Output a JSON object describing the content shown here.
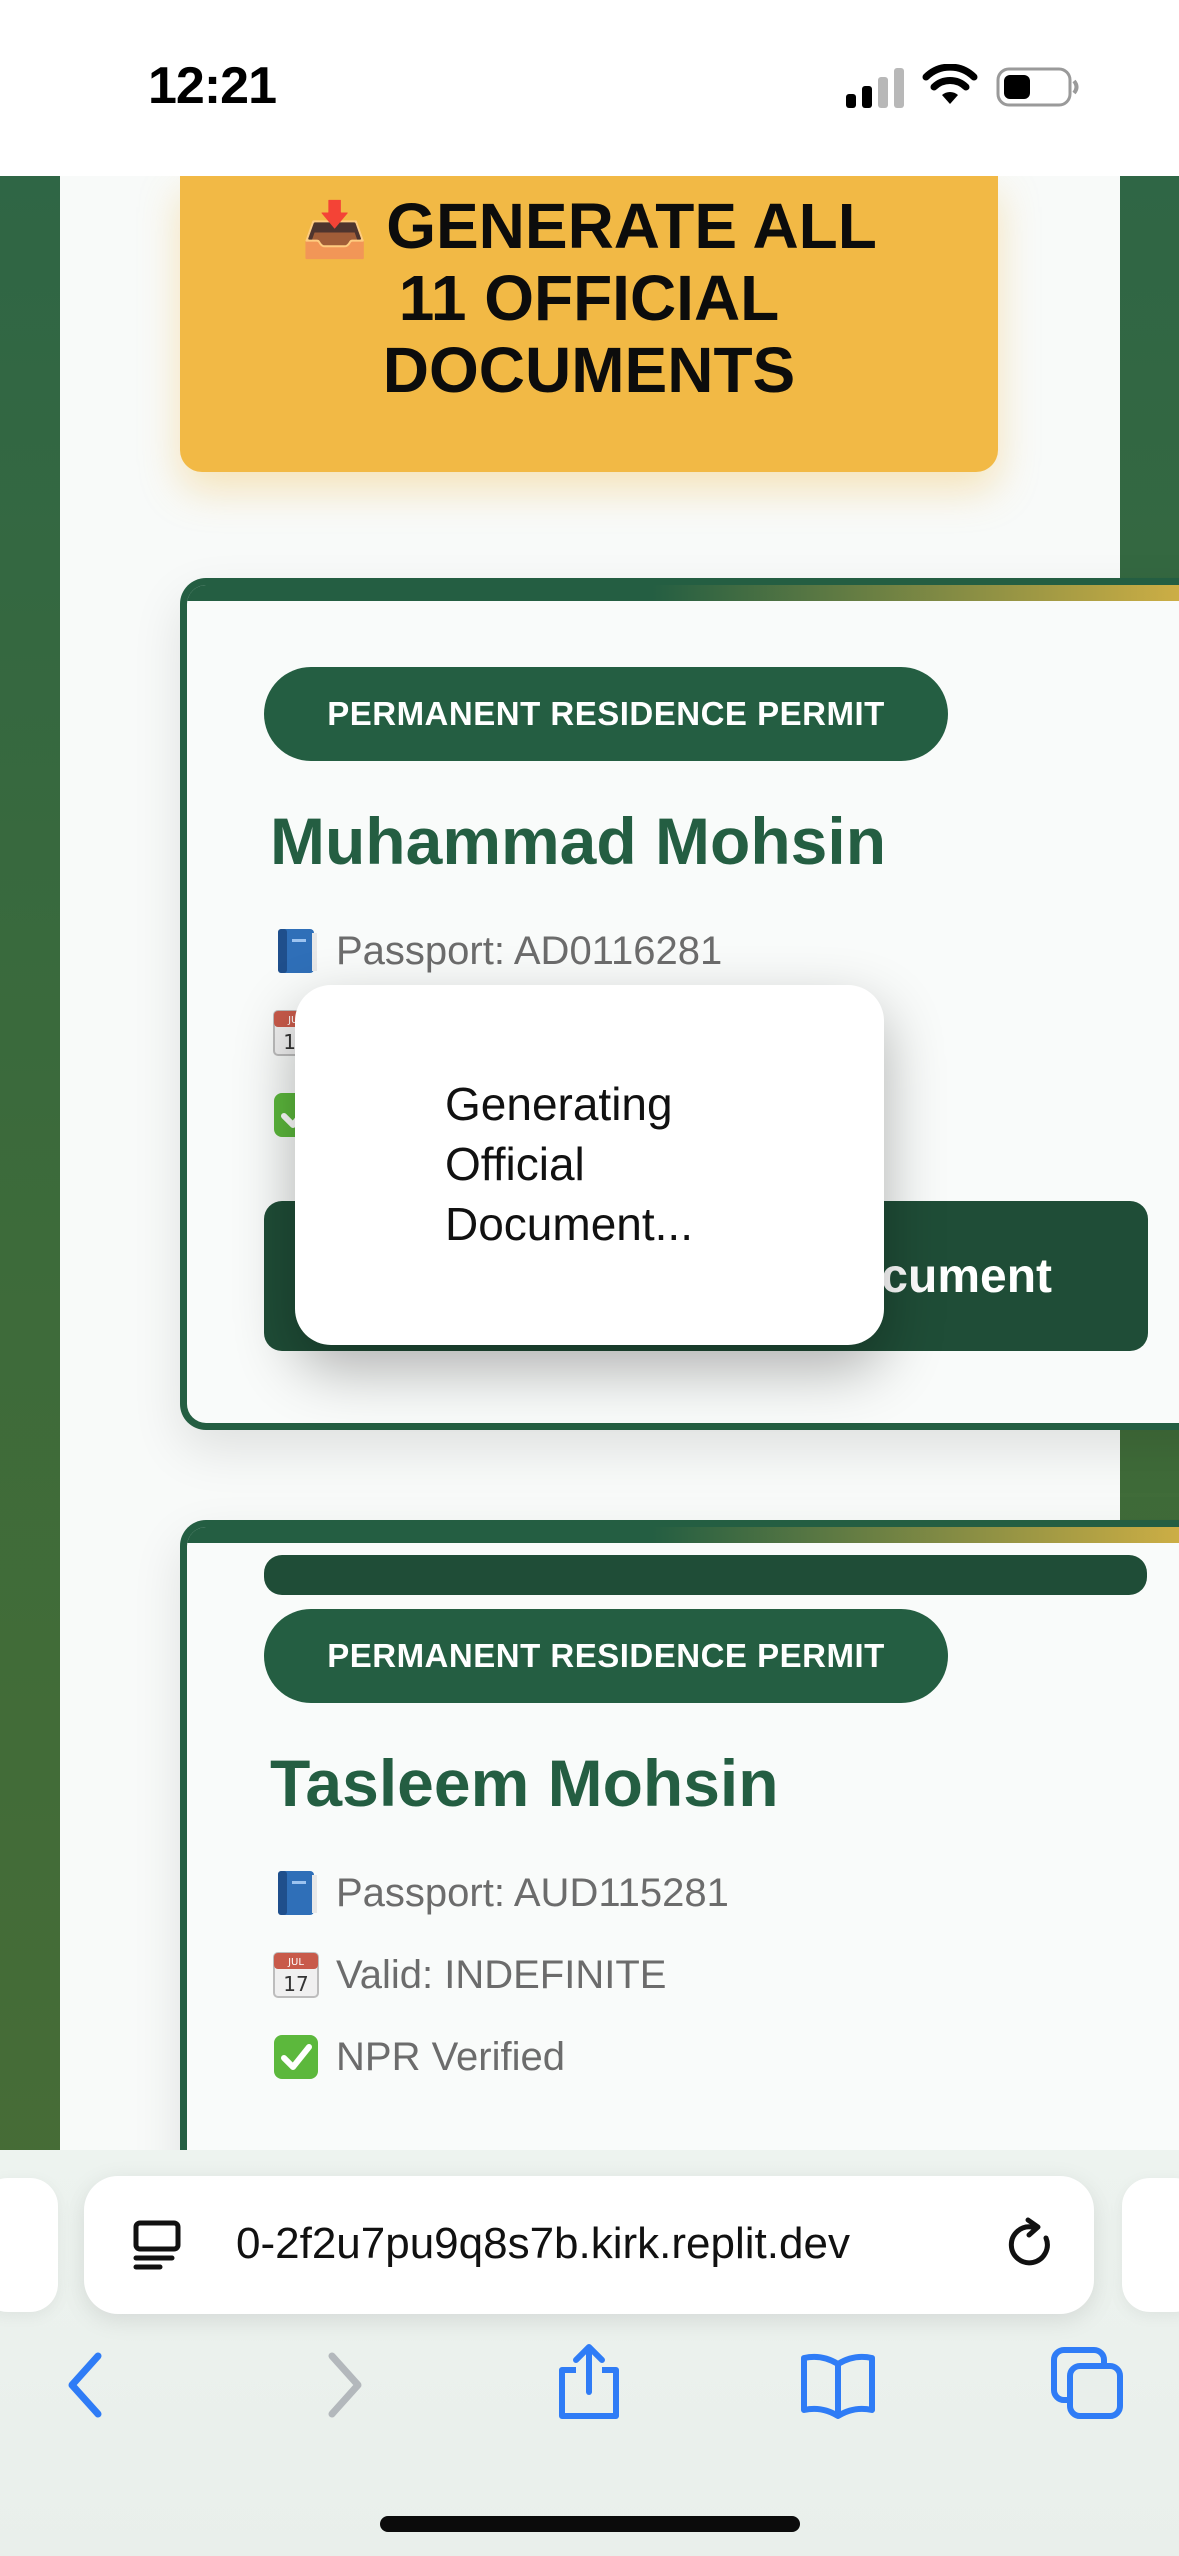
{
  "status_bar": {
    "time": "12:21"
  },
  "generate_button": {
    "icon": "inbox-tray-icon",
    "icon_glyph": "📥",
    "label": "GENERATE ALL 11 OFFICIAL DOCUMENTS"
  },
  "permits": [
    {
      "badge": "PERMANENT RESIDENCE PERMIT",
      "name": "Muhammad Mohsin",
      "passport": "Passport: AD0116281",
      "button_label": "cument"
    },
    {
      "badge": "PERMANENT RESIDENCE PERMIT",
      "name": "Tasleem Mohsin",
      "passport": "Passport: AUD115281",
      "valid": "Valid: INDEFINITE",
      "verified": "NPR Verified"
    }
  ],
  "icons": {
    "passport": "blue-book-icon",
    "calendar": "calendar-icon",
    "calendar_month": "JUL",
    "calendar_day": "17",
    "verified": "check-mark-button-icon"
  },
  "loading_popup": {
    "text": "Generating Official Document..."
  },
  "browser": {
    "url": "0-2f2u7pu9q8s7b.kirk.replit.dev"
  },
  "colors": {
    "brand_green": "#245e42",
    "dark_green": "#1f4d37",
    "gold": "#f2b945",
    "safari_blue": "#2f7cf6"
  }
}
